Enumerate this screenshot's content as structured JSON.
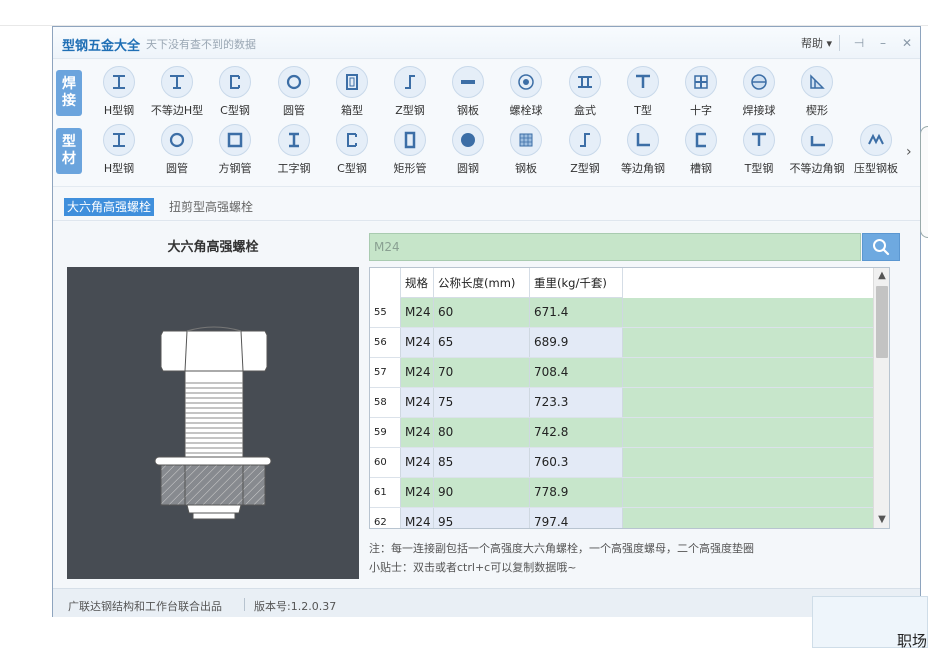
{
  "window": {
    "title": "型钢五金大全",
    "slogan": "天下没有查不到的数据",
    "help_label": "帮助 ▾",
    "pin_glyph": "⊣",
    "minimize_glyph": "–",
    "close_glyph": "✕"
  },
  "toolbar": {
    "welding": {
      "tag_line1": "焊",
      "tag_line2": "接",
      "items": [
        {
          "label": "H型钢",
          "icon": "h-beam-icon"
        },
        {
          "label": "不等边H型",
          "icon": "unequal-h-beam-icon"
        },
        {
          "label": "C型钢",
          "icon": "c-channel-icon"
        },
        {
          "label": "圆管",
          "icon": "round-pipe-icon"
        },
        {
          "label": "箱型",
          "icon": "box-section-icon"
        },
        {
          "label": "Z型钢",
          "icon": "z-section-icon"
        },
        {
          "label": "钢板",
          "icon": "steel-plate-icon"
        },
        {
          "label": "螺栓球",
          "icon": "bolt-ball-icon"
        },
        {
          "label": "盒式",
          "icon": "box-type-icon"
        },
        {
          "label": "T型",
          "icon": "t-section-icon"
        },
        {
          "label": "十字",
          "icon": "cross-section-icon"
        },
        {
          "label": "焊接球",
          "icon": "welded-ball-icon"
        },
        {
          "label": "楔形",
          "icon": "wedge-icon"
        }
      ]
    },
    "profiles": {
      "tag_line1": "型",
      "tag_line2": "材",
      "items": [
        {
          "label": "H型钢",
          "icon": "h-beam-icon"
        },
        {
          "label": "圆管",
          "icon": "round-pipe-icon"
        },
        {
          "label": "方钢管",
          "icon": "square-pipe-icon"
        },
        {
          "label": "工字钢",
          "icon": "i-beam-icon"
        },
        {
          "label": "C型钢",
          "icon": "c-channel-icon"
        },
        {
          "label": "矩形管",
          "icon": "rect-pipe-icon"
        },
        {
          "label": "圆钢",
          "icon": "round-bar-icon"
        },
        {
          "label": "钢板",
          "icon": "checker-plate-icon"
        },
        {
          "label": "Z型钢",
          "icon": "z-section-icon"
        },
        {
          "label": "等边角钢",
          "icon": "equal-angle-icon"
        },
        {
          "label": "槽钢",
          "icon": "channel-icon"
        },
        {
          "label": "T型钢",
          "icon": "t-section-icon"
        },
        {
          "label": "不等边角钢",
          "icon": "unequal-angle-icon"
        },
        {
          "label": "压型钢板",
          "icon": "profiled-plate-icon"
        }
      ],
      "more_glyph": "›"
    }
  },
  "tabs": [
    {
      "label": "大六角高强螺栓",
      "active": true
    },
    {
      "label": "扭剪型高强螺栓",
      "active": false
    }
  ],
  "product": {
    "title": "大六角高强螺栓"
  },
  "search": {
    "value": "M24",
    "placeholder": ""
  },
  "table": {
    "headers": [
      "",
      "规格",
      "公称长度(mm)",
      "重里(kg/千套)"
    ],
    "rows": [
      {
        "index": "55",
        "spec": "M24",
        "length": "60",
        "weight": "671.4"
      },
      {
        "index": "56",
        "spec": "M24",
        "length": "65",
        "weight": "689.9"
      },
      {
        "index": "57",
        "spec": "M24",
        "length": "70",
        "weight": "708.4"
      },
      {
        "index": "58",
        "spec": "M24",
        "length": "75",
        "weight": "723.3"
      },
      {
        "index": "59",
        "spec": "M24",
        "length": "80",
        "weight": "742.8"
      },
      {
        "index": "60",
        "spec": "M24",
        "length": "85",
        "weight": "760.3"
      },
      {
        "index": "61",
        "spec": "M24",
        "length": "90",
        "weight": "778.9"
      },
      {
        "index": "62",
        "spec": "M24",
        "length": "95",
        "weight": "797.4"
      }
    ]
  },
  "notes": {
    "note": "注：每一连接副包括一个高强度大六角螺栓，一个高强度螺母，二个高强度垫圈",
    "tip": "小贴士：双击或者ctrl+c可以复制数据哦~"
  },
  "status": {
    "company": "广联达钢结构和工作台联合出品",
    "version": "版本号:1.2.0.37"
  },
  "popup": {
    "text": "职场"
  },
  "colors": {
    "accent": "#3f8fdc",
    "title_blue": "#1f6fb5",
    "row_green": "#c7e6cb",
    "row_blue": "#e3eaf6",
    "image_bg": "#474c53"
  }
}
